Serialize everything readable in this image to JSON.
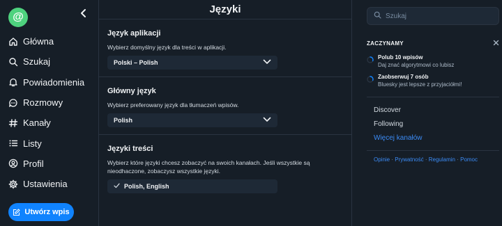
{
  "app": {
    "logo_glyph": "@"
  },
  "sidebar": {
    "items": [
      {
        "label": "Główna",
        "icon": "home-icon"
      },
      {
        "label": "Szukaj",
        "icon": "search-icon"
      },
      {
        "label": "Powiadomienia",
        "icon": "bell-icon"
      },
      {
        "label": "Rozmowy",
        "icon": "chat-icon"
      },
      {
        "label": "Kanały",
        "icon": "hash-icon"
      },
      {
        "label": "Listy",
        "icon": "list-icon"
      },
      {
        "label": "Profil",
        "icon": "user-icon"
      },
      {
        "label": "Ustawienia",
        "icon": "gear-icon"
      }
    ],
    "compose_label": "Utwórz wpis"
  },
  "main": {
    "title": "Języki",
    "sections": [
      {
        "title": "Język aplikacji",
        "desc": "Wybierz domyślny język dla treści w aplikacji.",
        "value": "Polski – Polish"
      },
      {
        "title": "Główny język",
        "desc": "Wybierz preferowany język dla tłumaczeń wpisów.",
        "value": "Polish"
      },
      {
        "title": "Języki treści",
        "desc": "Wybierz które języki chcesz zobaczyć na swoich kanałach. Jeśli wszystkie są nieodhaczone, zobaczysz wszystkie języki.",
        "value": "Polish, English"
      }
    ]
  },
  "right": {
    "search_placeholder": "Szukaj",
    "start_title": "ZACZYNAMY",
    "tasks": [
      {
        "title": "Polub 10 wpisów",
        "sub": "Daj znać algorytmowi co lubisz"
      },
      {
        "title": "Zaobserwuj 7 osób",
        "sub": "Bluesky jest lepsze z przyjaciółmi!"
      }
    ],
    "feeds": [
      "Discover",
      "Following",
      "Więcej kanałów"
    ],
    "footer": [
      "Opinie",
      "Prywatność",
      "Regulamin",
      "Pomoc"
    ]
  },
  "colors": {
    "background": "#161e27",
    "accent": "#1083fe",
    "avatar": "#4ed27e",
    "link": "#3b8bf5"
  }
}
